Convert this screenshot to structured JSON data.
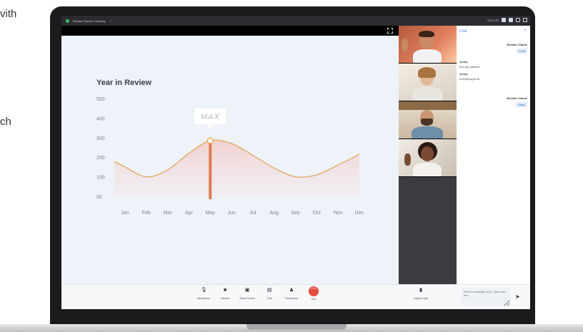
{
  "side_text": {
    "line1": "vith",
    "line2": "ch"
  },
  "window": {
    "title": "Nicolas Claude's meeting",
    "timer": "00:17:23"
  },
  "shared_chart": {
    "title": "Year in Review",
    "y_ticks": [
      "500",
      "400",
      "300",
      "200",
      "100",
      "00"
    ],
    "x_ticks": [
      "Jan",
      "Feb",
      "Mar",
      "Apr",
      "May",
      "Jun",
      "Jul",
      "Aug",
      "Sep",
      "Oct",
      "Nov",
      "Dec"
    ],
    "marker_label": "MAX",
    "line_color": "#e3a65a",
    "highlight_color": "#e07a4f"
  },
  "chart_data": {
    "type": "area",
    "title": "Year in Review",
    "categories": [
      "Jan",
      "Feb",
      "Mar",
      "Apr",
      "May",
      "Jun",
      "Jul",
      "Aug",
      "Sep",
      "Oct",
      "Nov",
      "Dec"
    ],
    "values": [
      150,
      100,
      135,
      220,
      285,
      270,
      210,
      145,
      100,
      110,
      160,
      215
    ],
    "ylim": [
      0,
      500
    ],
    "y_ticks": [
      0,
      100,
      200,
      300,
      400,
      500
    ],
    "annotation": {
      "label": "MAX",
      "category": "May",
      "value": 285
    },
    "grid": false,
    "legend": "none"
  },
  "participants": [
    {
      "name": "participant-1",
      "tile": "man-smiling-waving"
    },
    {
      "name": "participant-2",
      "tile": "woman-smiling"
    },
    {
      "name": "participant-3",
      "tile": "man-bearded"
    },
    {
      "name": "participant-4",
      "tile": "woman-waving"
    }
  ],
  "chat": {
    "header": "Chat",
    "close": "×",
    "messages": [
      {
        "sender": "Nicolas Claude",
        "text": "Hi all",
        "outgoing": true
      },
      {
        "sender": "Jenny",
        "text": "let's get started!",
        "outgoing": false
      },
      {
        "sender": "Jenny",
        "text": "Everything is ok.",
        "outgoing": false
      },
      {
        "sender": "Nicolas Claude",
        "text": "Okay.",
        "outgoing": true
      }
    ],
    "input_placeholder": "Send a message here. Type your text"
  },
  "toolbar": {
    "microphone": "Microphone",
    "camera": "Camera",
    "share_screen": "Share Screen",
    "chat": "Chat",
    "participants": "Participants",
    "end": "End",
    "upload_logs": "Upload Logs"
  }
}
